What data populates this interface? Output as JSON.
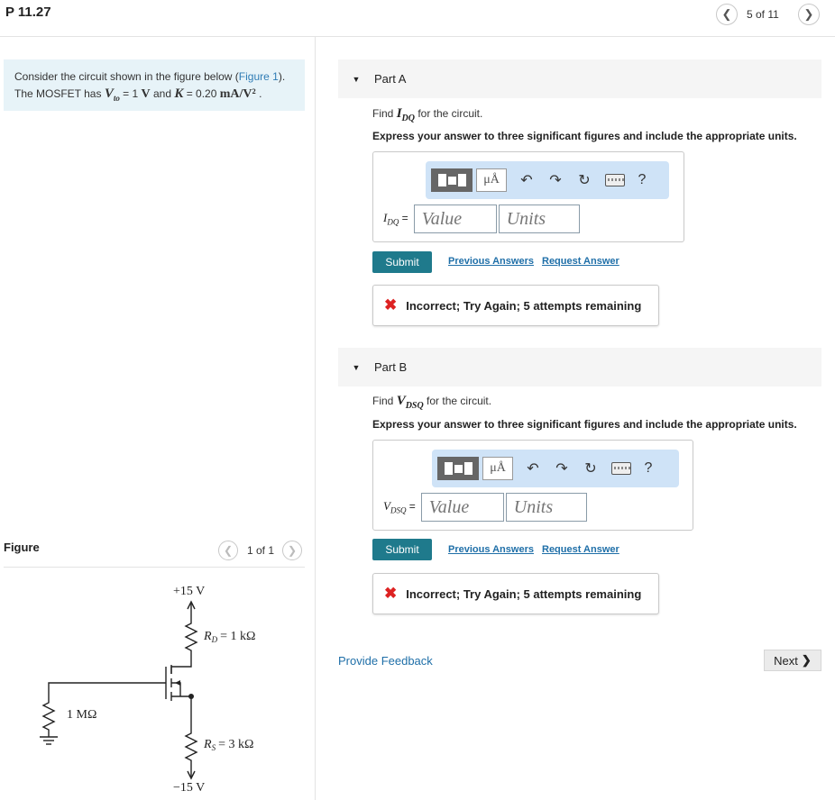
{
  "header": {
    "problem_title": "P 11.27",
    "counter": "5 of 11",
    "prev_icon": "chevron-left-icon",
    "next_icon": "chevron-right-icon"
  },
  "intro": {
    "line1_prefix": "Consider the circuit shown in the figure below (",
    "figure_link": "Figure 1",
    "line1_suffix": ").",
    "line2_prefix": "The MOSFET has ",
    "vto_sym": "V",
    "vto_sub": "to",
    "vto_val": " = 1 ",
    "vto_unit": "V",
    "and_k": " and ",
    "k_sym": "K",
    "k_val": " = 0.20 ",
    "k_unit": "mA/V²",
    "line2_suffix": " ."
  },
  "figure": {
    "label": "Figure",
    "counter": "1 of 1",
    "circuit": {
      "vdd": "+15 V",
      "rd": "= 1 kΩ",
      "rg": "1 MΩ",
      "rs": "= 3 kΩ",
      "vss": "−15 V"
    }
  },
  "parts": [
    {
      "title": "Part A",
      "find_prefix": "Find ",
      "find_sym": "I",
      "find_sub": "DQ",
      "find_suffix": " for the circuit.",
      "instruction": "Express your answer to three significant figures and include the appropriate units.",
      "answer_label_sym": "I",
      "answer_label_sub": "DQ",
      "answer_eq": " =",
      "value_placeholder": "Value",
      "units_placeholder": "Units",
      "submit": "Submit",
      "previous_answers": "Previous Answers",
      "request_answer": "Request Answer",
      "feedback": "Incorrect; Try Again; 5 attempts remaining"
    },
    {
      "title": "Part B",
      "find_prefix": "Find ",
      "find_sym": "V",
      "find_sub": "DSQ",
      "find_suffix": " for the circuit.",
      "instruction": "Express your answer to three significant figures and include the appropriate units.",
      "answer_label_sym": "V",
      "answer_label_sub": "DSQ",
      "answer_eq": " =",
      "value_placeholder": "Value",
      "units_placeholder": "Units",
      "submit": "Submit",
      "previous_answers": "Previous Answers",
      "request_answer": "Request Answer",
      "feedback": "Incorrect; Try Again; 5 attempts remaining"
    }
  ],
  "toolbar": {
    "mu_label": "μÅ",
    "undo": "↶",
    "redo": "↷",
    "reset": "↻",
    "help": "?"
  },
  "footer": {
    "provide_feedback": "Provide Feedback",
    "next": "Next"
  },
  "colors": {
    "intro_bg": "#e7f3f8",
    "submit_bg": "#1f7a8c",
    "toolbar_bg": "#cfe3f7",
    "error_x": "#dd2222",
    "link": "#1f6fa8"
  }
}
